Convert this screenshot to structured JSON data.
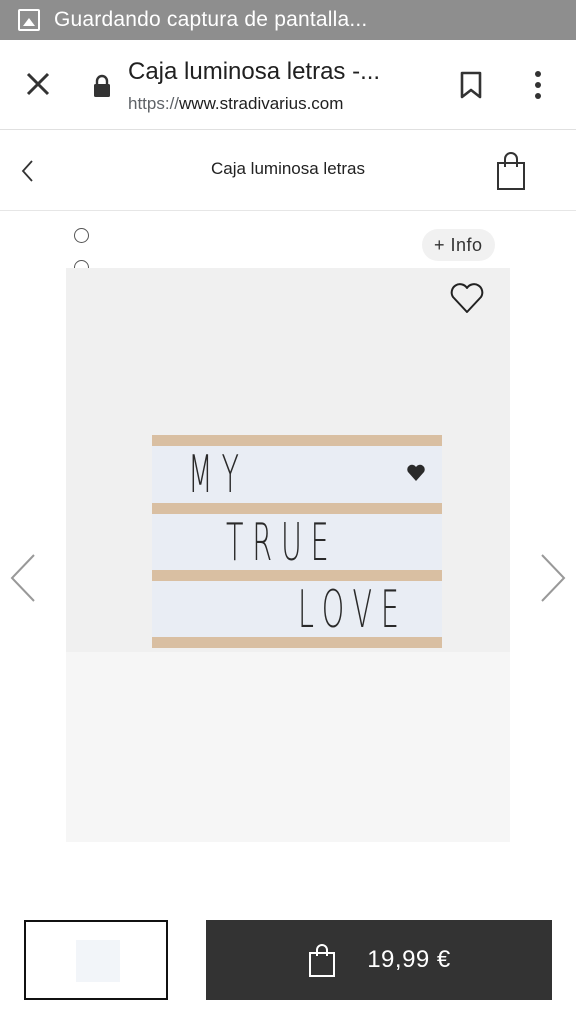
{
  "status_bar": {
    "notification_text": "Guardando captura de pantalla..."
  },
  "browser": {
    "page_title": "Caja luminosa letras -...",
    "url_scheme": "https://",
    "url_host": "www.stradivarius.com"
  },
  "header": {
    "title": "Caja luminosa letras"
  },
  "gallery": {
    "dot_count": 5,
    "active_index": 3,
    "info_button": "+ Info",
    "photo_lines": [
      "MY",
      "TRUE",
      "LOVE"
    ]
  },
  "buy_bar": {
    "price": "19,99 €"
  },
  "colors": {
    "status_bar": "#8e8e8e",
    "cart_button": "#333333",
    "frame_wood": "#d9bfa2"
  },
  "icons": [
    "close-icon",
    "lock-icon",
    "bookmark-icon",
    "more-vert-icon",
    "back-chevron-icon",
    "shopping-bag-icon",
    "heart-icon",
    "arrow-left-icon",
    "arrow-right-icon"
  ]
}
